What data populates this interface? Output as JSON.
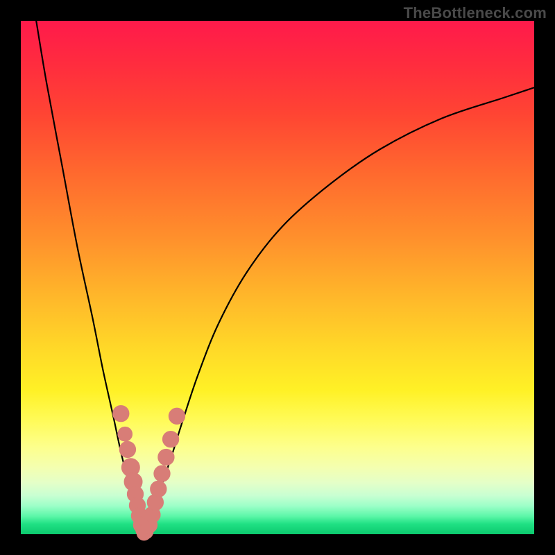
{
  "watermark": "TheBottleneck.com",
  "colors": {
    "frame": "#000000",
    "curve": "#000000",
    "dot": "#d87d77",
    "gradient_top": "#ff1a4b",
    "gradient_bottom": "#0cc96e"
  },
  "chart_data": {
    "type": "line",
    "title": "",
    "xlabel": "",
    "ylabel": "",
    "xlim": [
      0,
      100
    ],
    "ylim": [
      0,
      100
    ],
    "series": [
      {
        "name": "left-curve",
        "x": [
          3,
          5,
          8,
          11,
          14,
          16,
          18,
          19.5,
          21,
          22,
          22.8,
          23.4,
          23.8,
          24
        ],
        "y": [
          100,
          88,
          72,
          56,
          42,
          32,
          23,
          16,
          10,
          6,
          3,
          1.2,
          0.3,
          0
        ]
      },
      {
        "name": "right-curve",
        "x": [
          24,
          24.5,
          25.3,
          26.3,
          27.6,
          29.3,
          31.5,
          34.5,
          38.5,
          44,
          51,
          60,
          70,
          82,
          94,
          100
        ],
        "y": [
          0,
          1,
          3,
          6,
          10,
          15,
          22,
          31,
          41,
          51,
          60,
          68,
          75,
          81,
          85,
          87
        ]
      }
    ],
    "scatter_points": {
      "name": "highlight-dots",
      "points": [
        {
          "x": 19.5,
          "y": 23.5,
          "r": 1.3
        },
        {
          "x": 20.3,
          "y": 19.5,
          "r": 1.1
        },
        {
          "x": 20.8,
          "y": 16.5,
          "r": 1.3
        },
        {
          "x": 21.4,
          "y": 13.0,
          "r": 1.5
        },
        {
          "x": 21.9,
          "y": 10.2,
          "r": 1.5
        },
        {
          "x": 22.3,
          "y": 7.8,
          "r": 1.3
        },
        {
          "x": 22.7,
          "y": 5.6,
          "r": 1.3
        },
        {
          "x": 23.1,
          "y": 3.6,
          "r": 1.3
        },
        {
          "x": 23.5,
          "y": 1.8,
          "r": 1.3
        },
        {
          "x": 23.8,
          "y": 0.8,
          "r": 1.1
        },
        {
          "x": 24.0,
          "y": 0.2,
          "r": 1.1
        },
        {
          "x": 24.4,
          "y": 0.5,
          "r": 1.1
        },
        {
          "x": 25.0,
          "y": 1.8,
          "r": 1.3
        },
        {
          "x": 25.6,
          "y": 3.8,
          "r": 1.3
        },
        {
          "x": 26.2,
          "y": 6.2,
          "r": 1.3
        },
        {
          "x": 26.8,
          "y": 8.8,
          "r": 1.3
        },
        {
          "x": 27.5,
          "y": 11.8,
          "r": 1.3
        },
        {
          "x": 28.3,
          "y": 15.0,
          "r": 1.3
        },
        {
          "x": 29.2,
          "y": 18.5,
          "r": 1.3
        },
        {
          "x": 30.4,
          "y": 23.0,
          "r": 1.3
        }
      ]
    }
  }
}
